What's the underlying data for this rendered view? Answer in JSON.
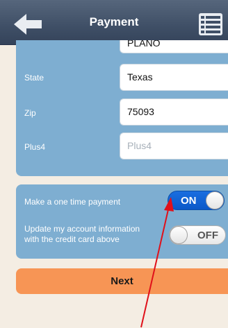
{
  "header": {
    "title": "Payment",
    "back_icon": "left-arrow-icon",
    "menu_icon": "list-menu-icon"
  },
  "address": {
    "city_value": "PLANO",
    "state_label": "State",
    "state_value": "Texas",
    "zip_label": "Zip",
    "zip_value": "75093",
    "plus4_label": "Plus4",
    "plus4_placeholder": "Plus4"
  },
  "options": {
    "one_time_label": "Make a one time payment",
    "one_time_state": "ON",
    "update_label_line1": "Update my account information",
    "update_label_line2": "with the credit card above",
    "update_state": "OFF"
  },
  "actions": {
    "next_label": "Next"
  },
  "colors": {
    "header": "#3f4f66",
    "card": "#7eaed1",
    "background": "#f4ede3",
    "toggle_on": "#0a58c8",
    "next_button": "#f79555",
    "annotation_arrow": "#e0101a"
  }
}
